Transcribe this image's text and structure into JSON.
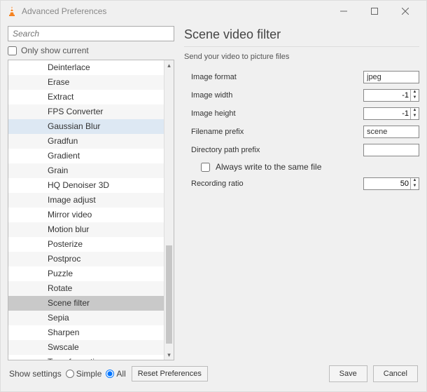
{
  "window": {
    "title": "Advanced Preferences"
  },
  "search": {
    "placeholder": "Search"
  },
  "only_show_current": "Only show current",
  "list": {
    "items": [
      "Deinterlace",
      "Erase",
      "Extract",
      "FPS Converter",
      "Gaussian Blur",
      "Gradfun",
      "Gradient",
      "Grain",
      "HQ Denoiser 3D",
      "Image adjust",
      "Mirror video",
      "Motion blur",
      "Posterize",
      "Postproc",
      "Puzzle",
      "Rotate",
      "Scene filter",
      "Sepia",
      "Sharpen",
      "Swscale",
      "Transformation"
    ],
    "highlighted_index": 4,
    "selected_index": 16
  },
  "panel": {
    "title": "Scene video filter",
    "desc": "Send your video to picture files",
    "fields": {
      "image_format": {
        "label": "Image format",
        "value": "jpeg"
      },
      "image_width": {
        "label": "Image width",
        "value": "-1"
      },
      "image_height": {
        "label": "Image height",
        "value": "-1"
      },
      "filename_prefix": {
        "label": "Filename prefix",
        "value": "scene"
      },
      "directory_path_prefix": {
        "label": "Directory path prefix",
        "value": ""
      },
      "always_write": {
        "label": "Always write to the same file",
        "checked": false
      },
      "recording_ratio": {
        "label": "Recording ratio",
        "value": "50"
      }
    }
  },
  "footer": {
    "show_settings_label": "Show settings",
    "simple": "Simple",
    "all": "All",
    "reset": "Reset Preferences",
    "save": "Save",
    "cancel": "Cancel"
  }
}
